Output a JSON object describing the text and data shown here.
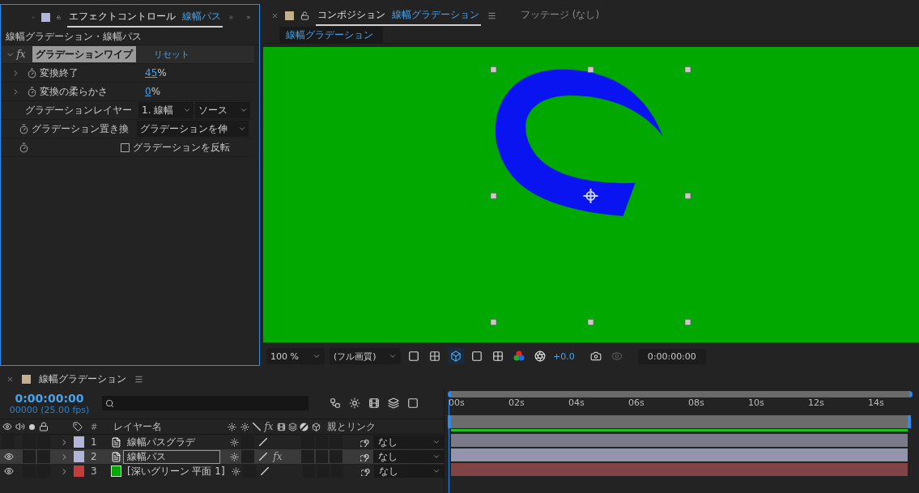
{
  "effect_panel": {
    "swatch": {
      "color": "#b4b4d8"
    },
    "title": "エフェクトコントロール",
    "layer": "線幅パス",
    "breadcrumb": "線幅グラデーション・線幅パス",
    "effect": {
      "fx": "fx",
      "name": "グラデーションワイプ",
      "reset": "リセット",
      "expanded": true
    },
    "properties": [
      {
        "kind": "value",
        "label": "変換終了",
        "value": "45",
        "unit": "%",
        "expanded": false
      },
      {
        "kind": "value",
        "label": "変換の柔らかさ",
        "value": "0",
        "unit": "%",
        "expanded": false
      },
      {
        "kind": "layer",
        "label": "グラデーションレイヤー",
        "options": [
          "1. 線幅",
          "ソース"
        ]
      },
      {
        "kind": "select",
        "label": "グラデーション置き換",
        "options": [
          "グラデーションを伸"
        ]
      },
      {
        "kind": "checkbox",
        "label": "グラデーションを反転",
        "checked": false
      }
    ]
  },
  "comp_panel": {
    "tabs": [
      {
        "kind": "composition",
        "swatch": {
          "color": "#c4b08c"
        },
        "label": "コンポジション",
        "name": "線幅グラデーション",
        "selected": true
      },
      {
        "kind": "footage",
        "label": "フッテージ (なし)",
        "selected": false
      }
    ],
    "breadcrumb": "線幅グラデーション",
    "toolbar": {
      "zoom": "100 %",
      "resolution": "(フル画質)",
      "exposure": "+0.0",
      "timecode": "0:00:00:00"
    }
  },
  "timeline": {
    "swatch": {
      "color": "#c4b08c"
    },
    "title": "線幅グラデーション",
    "timecode": "0:00:00:00",
    "frame_info": "00000 (25.00 fps)",
    "columns": {
      "number": "#",
      "layer_name": "レイヤー名",
      "fx": "fx",
      "parent": "親とリンク"
    },
    "ruler": [
      "00s",
      "02s",
      "04s",
      "06s",
      "08s",
      "10s",
      "12s",
      "14s"
    ],
    "layers": [
      {
        "number": "1",
        "kind": "shape",
        "name": "線幅パスグラデ",
        "color": "#b4b4d8",
        "visible": false,
        "selected": false,
        "parent": "なし"
      },
      {
        "number": "2",
        "kind": "shape",
        "name": "線幅パス",
        "color": "#b4b4d8",
        "visible": true,
        "selected": true,
        "fx_label": "fx",
        "parent": "なし"
      },
      {
        "number": "3",
        "kind": "solid",
        "solid": {
          "color": "#00a800"
        },
        "name": "[深いグリーン 平面 1]",
        "color": "#c43c3c",
        "visible": true,
        "selected": false,
        "parent": "なし"
      }
    ]
  }
}
